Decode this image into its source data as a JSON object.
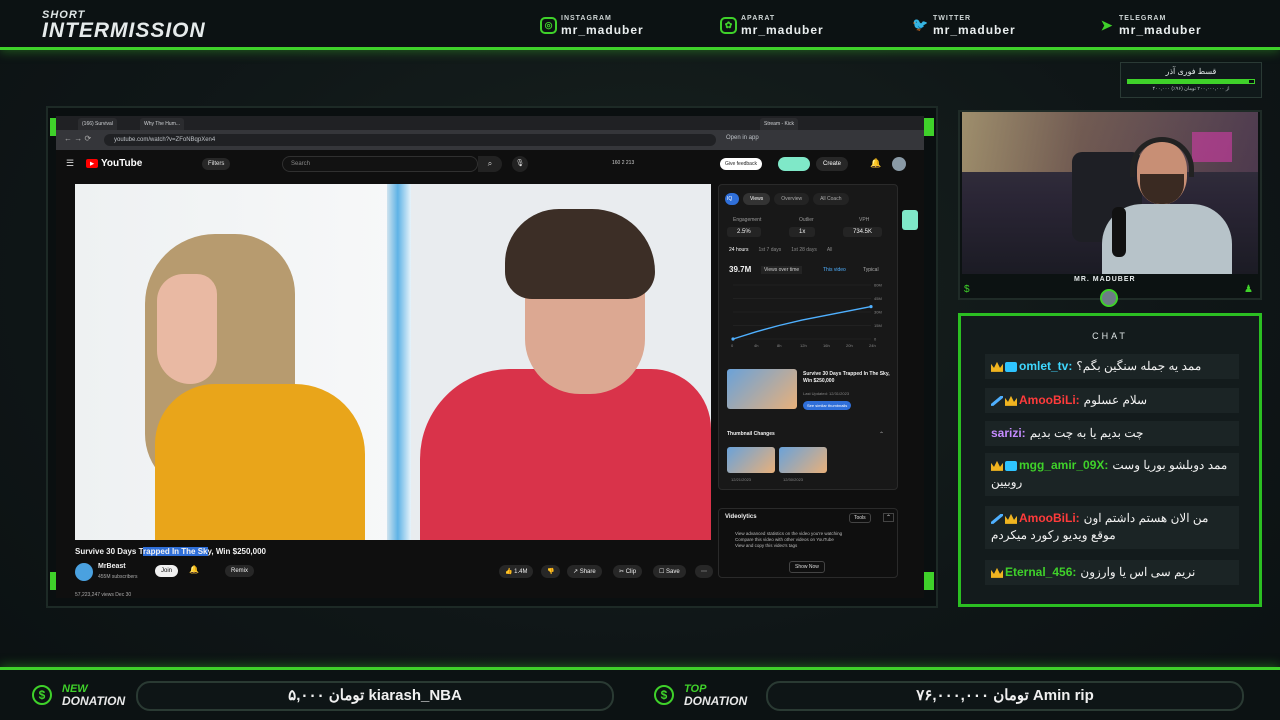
{
  "header": {
    "logo_small": "SHORT",
    "logo_big": "INTERMISSION",
    "socials": [
      {
        "label": "INSTAGRAM",
        "handle": "mr_maduber",
        "icon": "instagram-icon"
      },
      {
        "label": "APARAT",
        "handle": "mr_maduber",
        "icon": "aparat-icon"
      },
      {
        "label": "TWITTER",
        "handle": "mr_maduber",
        "icon": "twitter-icon"
      },
      {
        "label": "TELEGRAM",
        "handle": "mr_maduber",
        "icon": "telegram-icon"
      }
    ]
  },
  "goal": {
    "title": "قسط فوری آذر",
    "sub": "۴۰۰,۰۰۰ از ۲۰۰,۰۰۰,۰۰۰ تومان (۹۶٪)"
  },
  "browser": {
    "tabs": [
      "(166) Survival",
      "Why The Hum...",
      "Stream - Kick"
    ],
    "url": "youtube.com/watch?v=ZFoNBqpXen4",
    "open_in_app": "Open in app",
    "yt_logo": "YouTube",
    "filters": "Filters",
    "search_placeholder": "Search",
    "feedback": "Give feedback",
    "create": "Create",
    "counts": "160  2  213"
  },
  "video": {
    "title_pre": "Survive 30 Days T",
    "title_hl": "rapped In The Sk",
    "title_post": "y, Win $250,000",
    "channel": "MrBeast",
    "subs": "455M subscribers",
    "join": "Join",
    "remix": "Remix",
    "likes": "1.4M",
    "share": "Share",
    "clip": "Clip",
    "save": "Save",
    "views_line": "57,223,247 views  Dec 30"
  },
  "side_panel": {
    "tabs": [
      "Views",
      "Overview",
      "All Coach"
    ],
    "metrics": [
      {
        "label": "Engagement",
        "value": "2.5%"
      },
      {
        "label": "Outlier",
        "value": "1x"
      },
      {
        "label": "VPH",
        "value": "734.5K"
      }
    ],
    "ranges": [
      "24 hours",
      "1st 7 days",
      "1st 28 days",
      "All"
    ],
    "views_total": "39.7M",
    "views_over_time": "Views over time",
    "this_video": "This video",
    "typical": "Typical",
    "y_ticks": [
      "60M",
      "45M",
      "30M",
      "15M",
      "0"
    ],
    "x_ticks": [
      "0",
      "4h",
      "8h",
      "12h",
      "16h",
      "20h",
      "24h"
    ],
    "chart_values": [
      0,
      8,
      15,
      21,
      26,
      31,
      36
    ],
    "similar_title": "Survive 30 Days Trapped In The Sky, Win $250,000",
    "similar_meta": "Last Updated: 12/31/2023",
    "similar_btn": "See similar thumbnails",
    "thumb_changes": "Thumbnail Changes",
    "thumb_dates": [
      "12/21/2023",
      "12/30/2023"
    ]
  },
  "videolytics": {
    "title": "Videolytics",
    "tools": "Tools",
    "items": [
      "View advanced statistics on the video you're watching",
      "Compare this video with other videos on YouTube",
      "View and copy this video's tags"
    ],
    "show_now": "Show Now"
  },
  "webcam": {
    "name": "MR. MADUBER"
  },
  "chat": {
    "header": "CHAT",
    "messages": [
      {
        "user": "omlet_tv:",
        "text": "ممد یه جمله سنگین بگم؟",
        "color": "#3fd8ff",
        "badges": [
          "crown",
          "sq"
        ]
      },
      {
        "user": "AmooBiLi:",
        "text": "سلام عسلوم",
        "color": "#ff3b3b",
        "badges": [
          "sword",
          "crown"
        ]
      },
      {
        "user": "sarizi:",
        "text": "چت بدیم یا به چت بدیم",
        "color": "#c48bff",
        "badges": []
      },
      {
        "user": "mgg_amir_09X:",
        "text": "ممد دوبلشو بوریا وست روبیین",
        "color": "#3fd12a",
        "badges": [
          "crown",
          "sq"
        ]
      },
      {
        "user": "AmooBiLi:",
        "text": "من الان هستم داشتم اون موقع ویدیو رکورد میکردم",
        "color": "#ff3b3b",
        "badges": [
          "sword",
          "crown"
        ]
      },
      {
        "user": "Eternal_456:",
        "text": "نریم سی اس یا وارزون",
        "color": "#3fd12a",
        "badges": [
          "crown"
        ]
      }
    ]
  },
  "donations": {
    "new_label_1": "NEW",
    "new_label_2": "DONATION",
    "new_value": "۵,۰۰۰ تومان  kiarash_NBA",
    "top_label_1": "TOP",
    "top_label_2": "DONATION",
    "top_value": "۷۶,۰۰۰,۰۰۰ تومان  Amin rip"
  },
  "colors": {
    "accent": "#3fd12a",
    "background": "#0f1718"
  }
}
